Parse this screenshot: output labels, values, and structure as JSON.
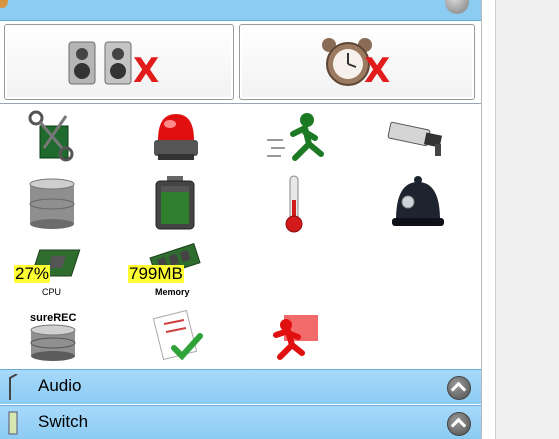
{
  "buttons": {
    "speakers_off": "speakers-mute",
    "alarm_off": "alarm-off"
  },
  "metrics": {
    "cpu": {
      "value": "27%",
      "label": "CPU"
    },
    "memory": {
      "value": "799MB",
      "label": "Memory"
    }
  },
  "widgets": {
    "surerec_label": "sureREC"
  },
  "sections": [
    {
      "title": "Audio"
    },
    {
      "title": "Switch"
    }
  ],
  "colors": {
    "section_blue": "#8ccbf2",
    "highlight_yellow": "#ffff33",
    "x_red": "#e21b1b"
  }
}
